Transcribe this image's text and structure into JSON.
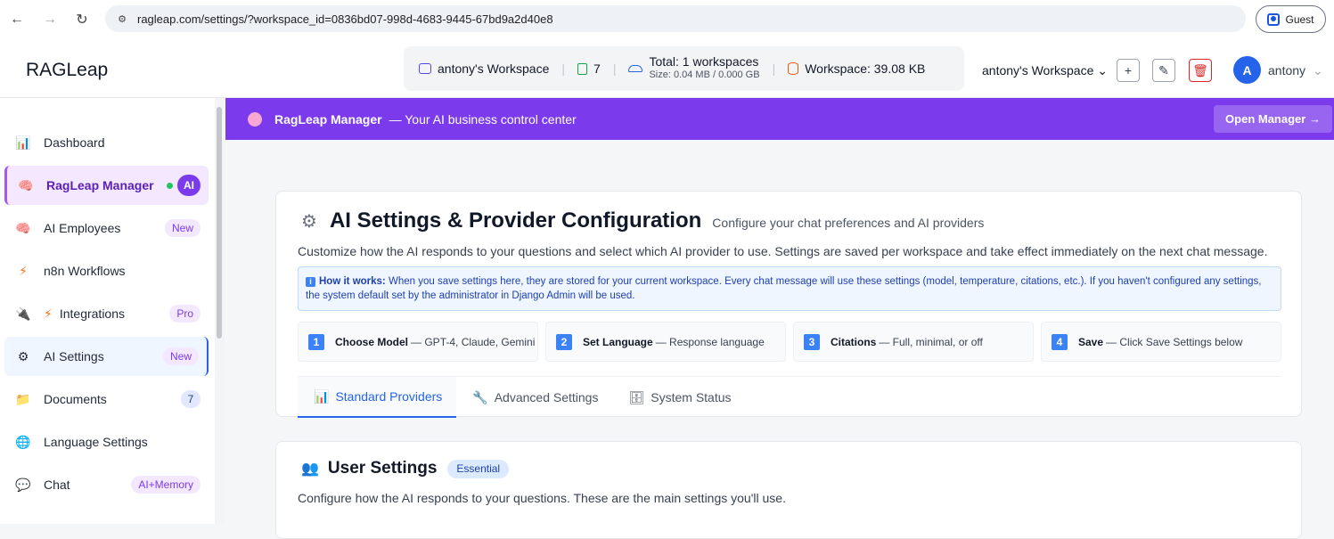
{
  "browser": {
    "url": "ragleap.com/settings/?workspace_id=0836bd07-998d-4683-9445-67bd9a2d40e8",
    "profile": "Guest"
  },
  "header": {
    "brand": "RAGLeap",
    "workspace_name": "antony's Workspace",
    "doc_count": "7",
    "total_workspaces": "Total: 1 workspaces",
    "size_info": "Size: 0.04 MB / 0.000 GB",
    "workspace_size": "Workspace: 39.08 KB",
    "workspace_select": "antony's Workspace",
    "avatar_letter": "A",
    "user": "antony"
  },
  "sidebar": {
    "items": [
      {
        "label": "Dashboard",
        "icon": "bar-chart-icon"
      },
      {
        "label": "RagLeap Manager",
        "badge": "AI",
        "icon": "brain-icon"
      },
      {
        "label": "AI Employees",
        "badge": "New",
        "icon": "brain-icon"
      },
      {
        "label": "n8n Workflows",
        "icon": "lightning-icon"
      },
      {
        "label": "Integrations",
        "badge": "Pro",
        "icon": "plug-icon"
      },
      {
        "label": "AI Settings",
        "badge": "New",
        "icon": "gear-icon"
      },
      {
        "label": "Documents",
        "badge": "7",
        "icon": "folder-icon"
      },
      {
        "label": "Language Settings",
        "icon": "globe-icon"
      },
      {
        "label": "Chat",
        "badge": "AI+Memory",
        "icon": "speech-bubble-icon"
      }
    ]
  },
  "banner": {
    "title": "RagLeap Manager",
    "subtitle": "— Your AI business control center",
    "button": "Open Manager →"
  },
  "settings": {
    "title": "AI Settings & Provider Configuration",
    "subtitle": "Configure your chat preferences and AI providers",
    "description": "Customize how the AI responds to your questions and select which AI provider to use. Settings are saved per workspace and take effect immediately on the next chat message.",
    "info_label": "How it works:",
    "info_text": "When you save settings here, they are stored for your current workspace. Every chat message will use these settings (model, temperature, citations, etc.). If you haven't configured any settings, the system default set by the administrator in Django Admin will be used.",
    "steps": [
      {
        "num": "1",
        "title": "Choose Model",
        "text": "— GPT-4, Claude, Gemini"
      },
      {
        "num": "2",
        "title": "Set Language",
        "text": "— Response language"
      },
      {
        "num": "3",
        "title": "Citations",
        "text": "— Full, minimal, or off"
      },
      {
        "num": "4",
        "title": "Save",
        "text": "— Click Save Settings below"
      }
    ],
    "tabs": [
      "Standard Providers",
      "Advanced Settings",
      "System Status"
    ]
  },
  "user_settings": {
    "title": "User Settings",
    "badge": "Essential",
    "description": "Configure how the AI responds to your questions. These are the main settings you'll use."
  }
}
